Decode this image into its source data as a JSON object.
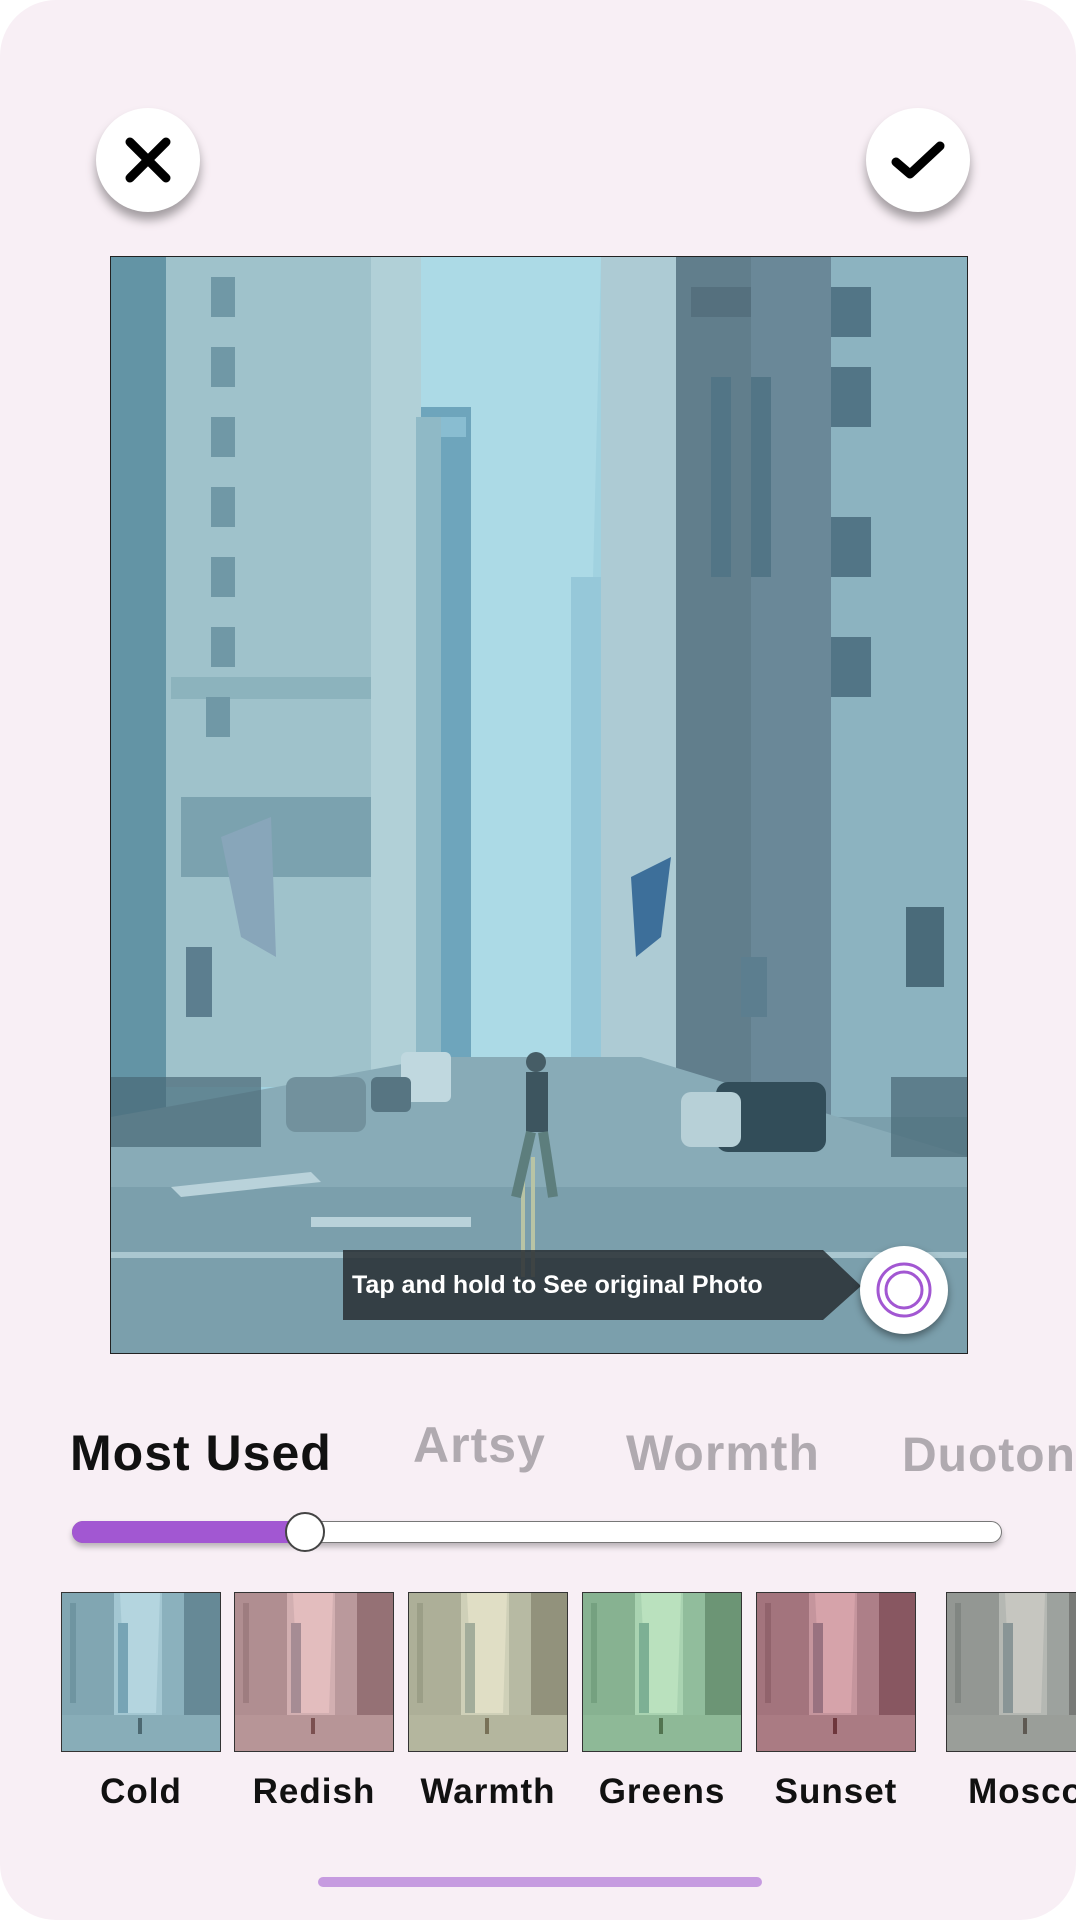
{
  "toolbar": {
    "close_icon": "close-icon",
    "confirm_icon": "checkmark-icon"
  },
  "preview": {
    "hint_text": "Tap and hold to See original Photo",
    "compare_icon": "concentric-circle-icon",
    "tint_color": "#7fc3d6"
  },
  "categories": {
    "active": "Most Used",
    "items": [
      "Most Used",
      "Artsy",
      "Wormth",
      "Duoton"
    ]
  },
  "intensity": {
    "value": 0.25,
    "accent": "#a257d2"
  },
  "filters": [
    {
      "label": "Cold",
      "tint": "#6fb2c8"
    },
    {
      "label": "Redish",
      "tint": "#e07a7a"
    },
    {
      "label": "Warmth",
      "tint": "#d9c98a"
    },
    {
      "label": "Greens",
      "tint": "#7fd07a"
    },
    {
      "label": "Sunset",
      "tint": "#c23c4a"
    },
    {
      "label": "Mosco",
      "tint": "#9a8f7f"
    }
  ]
}
